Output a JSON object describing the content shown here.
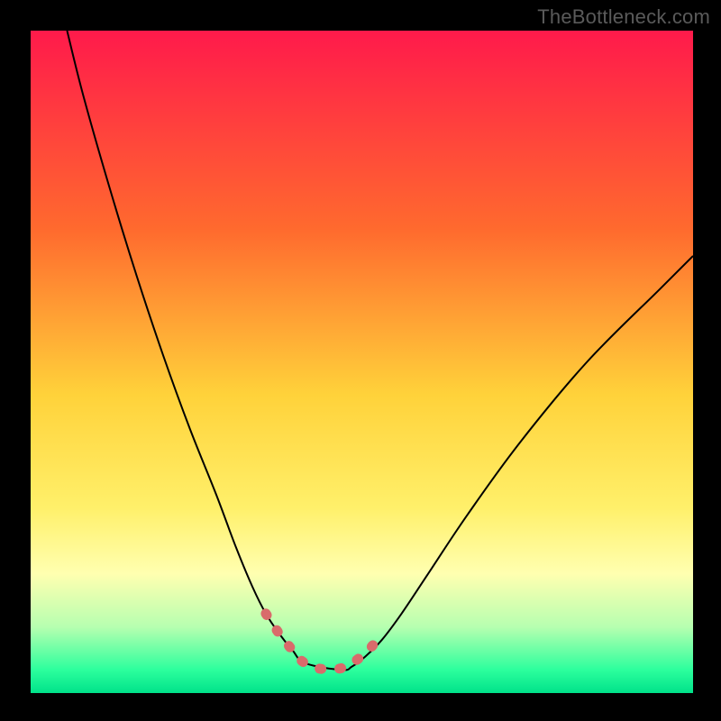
{
  "watermark": "TheBottleneck.com",
  "chart_data": {
    "type": "line",
    "title": "",
    "xlabel": "",
    "ylabel": "",
    "xlim": [
      0,
      100
    ],
    "ylim": [
      0,
      100
    ],
    "grid": false,
    "legend": false,
    "gradient": {
      "stops": [
        {
          "offset": 0.0,
          "color": "#ff1a4b"
        },
        {
          "offset": 0.3,
          "color": "#ff6a2e"
        },
        {
          "offset": 0.55,
          "color": "#ffd23a"
        },
        {
          "offset": 0.72,
          "color": "#fff06a"
        },
        {
          "offset": 0.82,
          "color": "#ffffb0"
        },
        {
          "offset": 0.9,
          "color": "#b7ffb0"
        },
        {
          "offset": 0.965,
          "color": "#2cff9d"
        },
        {
          "offset": 1.0,
          "color": "#00e28a"
        }
      ]
    },
    "series": [
      {
        "name": "curve",
        "stroke": "#000000",
        "stroke_width": 2,
        "x": [
          5.5,
          8,
          12,
          16,
          20,
          24,
          28,
          31,
          33.5,
          35.5,
          37.5,
          39.5,
          41.5,
          47,
          48.5,
          50.5,
          53,
          56,
          60,
          66,
          74,
          84,
          95,
          100
        ],
        "y": [
          100,
          90,
          76,
          63,
          51,
          40,
          30,
          22,
          16,
          12,
          9,
          6.5,
          4.5,
          3.5,
          4,
          5.5,
          8,
          12,
          18,
          27,
          38,
          50,
          61,
          66
        ]
      },
      {
        "name": "minimum-marker",
        "stroke": "#d96b6b",
        "stroke_width": 11,
        "linecap": "round",
        "dash": "2 20",
        "x": [
          35.5,
          37.5,
          39.5,
          41,
          43,
          46,
          48,
          49.5,
          51,
          52.5
        ],
        "y": [
          12,
          9,
          6.5,
          4.8,
          3.8,
          3.6,
          4.2,
          5.2,
          6.5,
          8.2
        ]
      }
    ]
  }
}
